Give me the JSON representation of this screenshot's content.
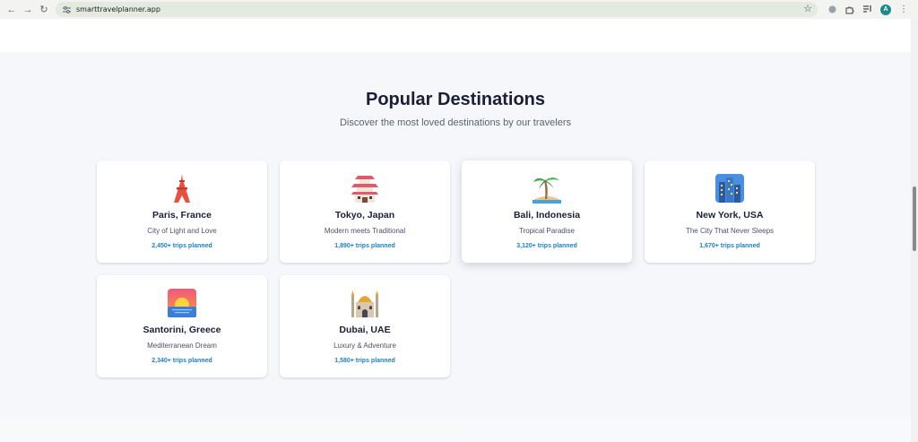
{
  "browser": {
    "url": "smarttravelplanner.app",
    "avatar_letter": "A"
  },
  "section": {
    "title": "Popular Destinations",
    "subtitle": "Discover the most loved destinations by our travelers"
  },
  "destinations": [
    {
      "name": "Paris, France",
      "tagline": "City of Light and Love",
      "trips": "2,450+ trips planned",
      "icon": "eiffel-tower-icon"
    },
    {
      "name": "Tokyo, Japan",
      "tagline": "Modern meets Traditional",
      "trips": "1,890+ trips planned",
      "icon": "japanese-castle-icon"
    },
    {
      "name": "Bali, Indonesia",
      "tagline": "Tropical Paradise",
      "trips": "3,120+ trips planned",
      "icon": "palm-island-icon"
    },
    {
      "name": "New York, USA",
      "tagline": "The City That Never Sleeps",
      "trips": "1,670+ trips planned",
      "icon": "cityscape-icon"
    },
    {
      "name": "Santorini, Greece",
      "tagline": "Mediterranean Dream",
      "trips": "2,340+ trips planned",
      "icon": "sunset-icon"
    },
    {
      "name": "Dubai, UAE",
      "tagline": "Luxury & Adventure",
      "trips": "1,580+ trips planned",
      "icon": "mosque-icon"
    }
  ],
  "colors": {
    "accent_link": "#1e7fc0",
    "heading": "#1a1f36",
    "section_bg": "#f5f7fb"
  }
}
